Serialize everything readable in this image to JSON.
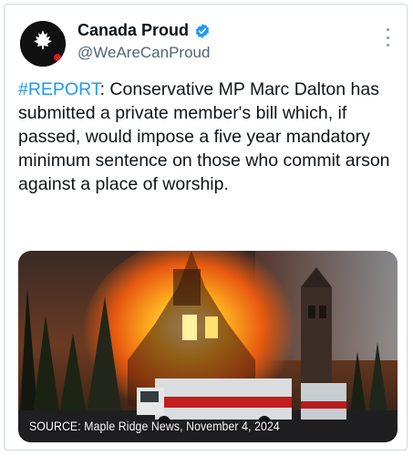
{
  "post": {
    "author_name": "Canada Proud",
    "handle": "@WeAreCanProud",
    "avatar_text": "CANADA PROUD",
    "hashtag": "#REPORT",
    "body": ": Conservative MP Marc Dalton has submitted a private member's bill which, if passed, would impose a five year mandatory minimum sentence on those who commit arson against a place of worship."
  },
  "media": {
    "caption": "SOURCE: Maple Ridge News, November 4, 2024",
    "icon": "church-fire-photo"
  },
  "icons": {
    "verified": "verified-badge-icon",
    "more": "more-options-icon"
  },
  "colors": {
    "link": "#1d9bf0",
    "text": "#0f1419",
    "muted": "#536471",
    "border": "#cfd9de"
  }
}
